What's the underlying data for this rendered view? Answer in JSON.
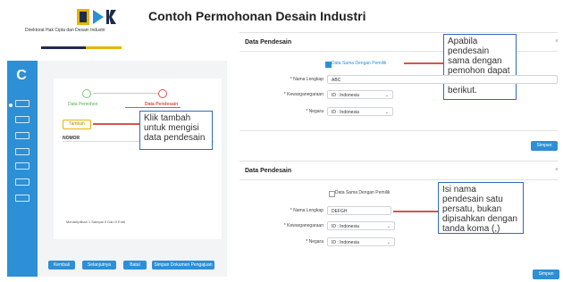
{
  "header": {
    "org_subtitle": "Direktorat Hak Cipta dan Desain Industri",
    "logo_text": "DJKI",
    "title": "Contoh Permohonan Desain Industri"
  },
  "left_app": {
    "steps": [
      {
        "label": "Data Pemohon"
      },
      {
        "label": "Data Pendesain"
      }
    ],
    "tambah_label": "Tambah",
    "column_header": "NOMOR",
    "pagination_text": "Menampilkan 1 Sampai 0 Dari 0 Entri",
    "bottom_buttons": [
      "Kembali",
      "Selanjutnya",
      "Batal",
      "Simpan Dokumen Pengajuan"
    ]
  },
  "callouts": {
    "tambah": "Klik tambah untuk mengisi data pendesain",
    "checklist": "Apabila pendesain sama dengan pemohon dapat check list tanda berikut.",
    "nama": "Isi nama pendesain satu persatu, bukan dipisahkan dengan tanda koma (,)"
  },
  "panel1": {
    "title": "Data Pendesain",
    "close": "×",
    "checkbox_label": "Data Sama Dengan Pemilik",
    "fields": [
      {
        "label": "* Nama Lengkap",
        "value": "ABC"
      },
      {
        "label": "* Kewarganegaraan",
        "value": "ID : Indonesia"
      },
      {
        "label": "* Negara",
        "value": "ID : Indonesia"
      }
    ],
    "save_label": "Simpan"
  },
  "panel2": {
    "title": "Data Pendesain",
    "close": "×",
    "checkbox_label": "Data Sama Dengan Pemilik",
    "fields": [
      {
        "label": "* Nama Lengkap",
        "value": "DEFGH"
      },
      {
        "label": "* Kewarganegaraan",
        "value": "ID : Indonesia"
      },
      {
        "label": "* Negara",
        "value": "ID : Indonesia"
      }
    ],
    "save_label": "Simpan"
  },
  "colors": {
    "brand_blue": "#2d8fd6",
    "accent_yellow": "#e8b400",
    "navy": "#1f2b4d",
    "callout_border": "#2e6bb8",
    "red_pointer": "#d9534f"
  }
}
